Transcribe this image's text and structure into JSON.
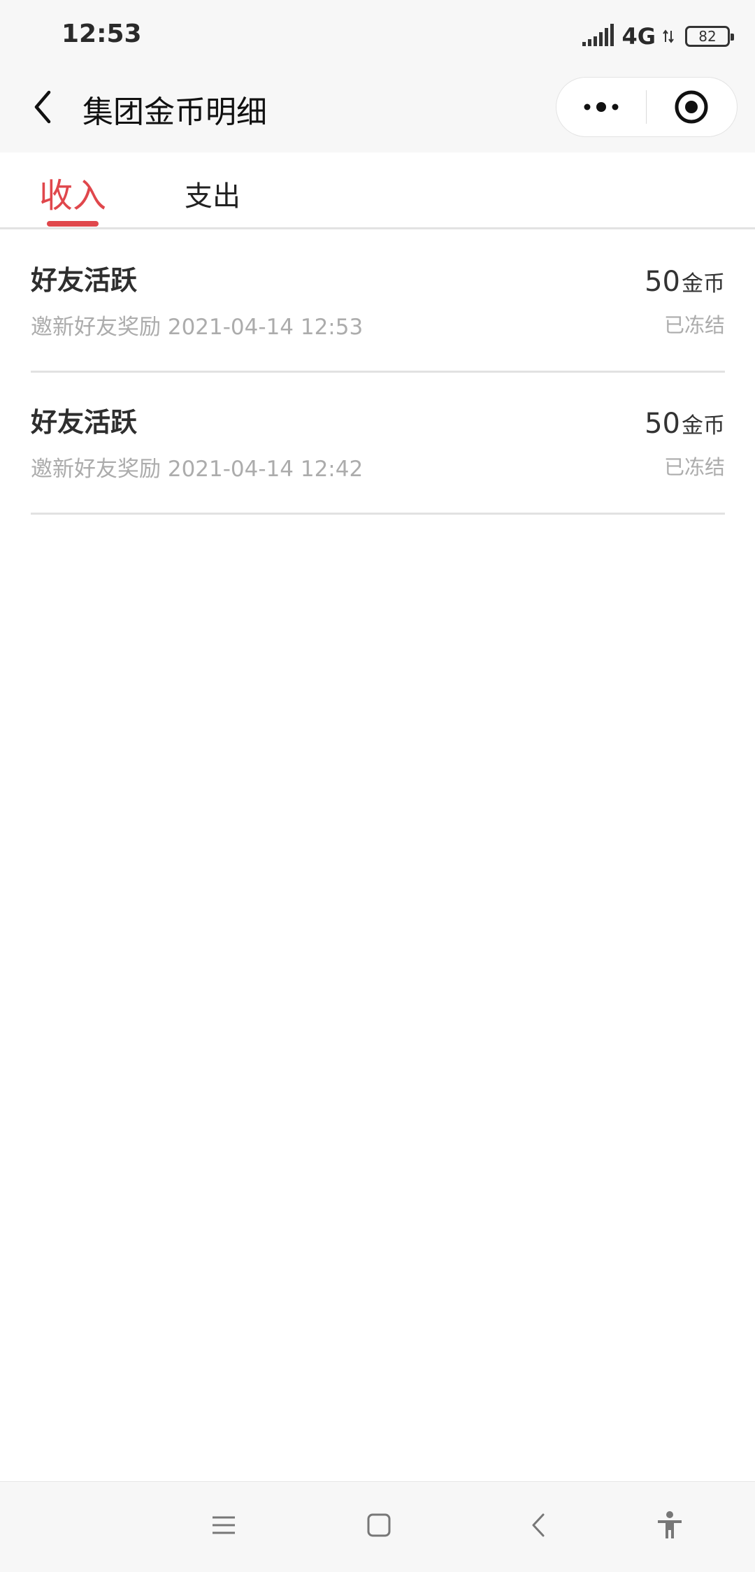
{
  "status_bar": {
    "time": "12:53",
    "network": "4G",
    "battery": "82"
  },
  "nav": {
    "title": "集团金币明细"
  },
  "tabs": [
    {
      "label": "收入",
      "active": true
    },
    {
      "label": "支出",
      "active": false
    }
  ],
  "records": [
    {
      "title": "好友活跃",
      "desc": "邀新好友奖励 2021-04-14 12:53",
      "amount": "50",
      "unit": "金币",
      "status": "已冻结"
    },
    {
      "title": "好友活跃",
      "desc": "邀新好友奖励 2021-04-14 12:42",
      "amount": "50",
      "unit": "金币",
      "status": "已冻结"
    }
  ],
  "colors": {
    "accent": "#e0474c",
    "muted_text": "#acacac",
    "bar_background": "#f7f7f7"
  },
  "icons": {
    "back": "chevron-left-icon",
    "more": "more-dots-icon",
    "close": "target-circle-icon",
    "menu": "menu-lines-icon",
    "home": "square-home-icon",
    "sys_back": "chevron-left-icon",
    "accessibility": "accessibility-icon"
  }
}
